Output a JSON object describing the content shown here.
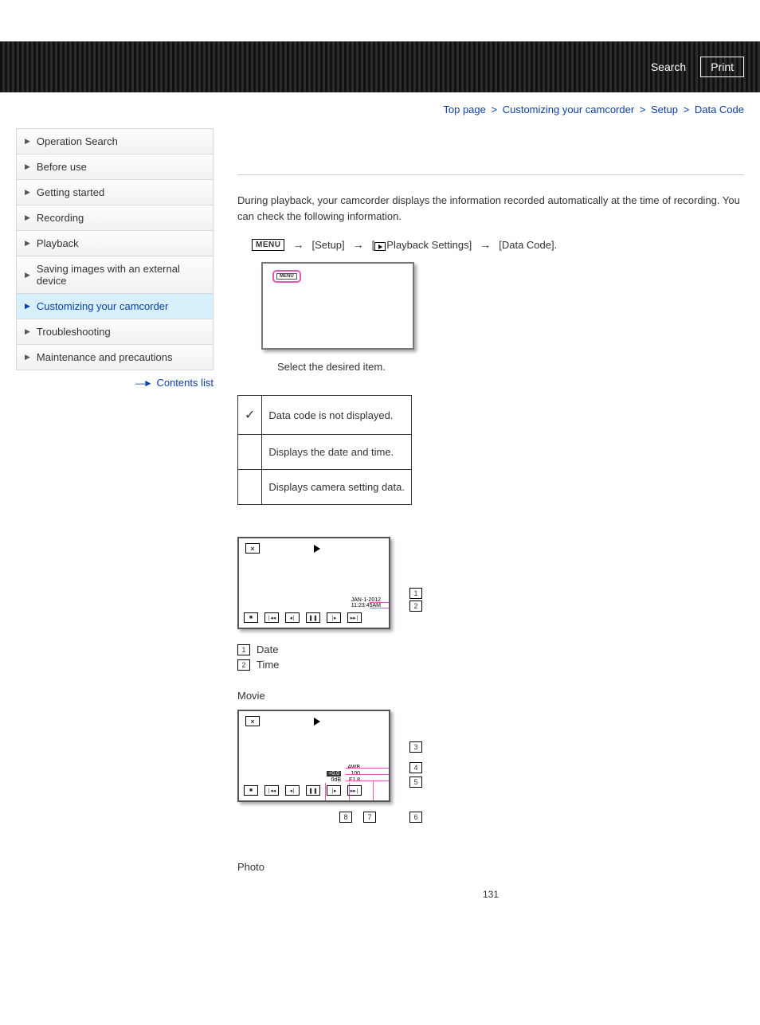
{
  "banner": {
    "search": "Search",
    "print": "Print"
  },
  "breadcrumbs": {
    "top": "Top page",
    "c1": "Customizing your camcorder",
    "c2": "Setup",
    "current": "Data Code"
  },
  "sidebar": {
    "items": [
      "Operation Search",
      "Before use",
      "Getting started",
      "Recording",
      "Playback",
      "Saving images with an external device",
      "Customizing your camcorder",
      "Troubleshooting",
      "Maintenance and precautions"
    ],
    "contents_link": "Contents list"
  },
  "main": {
    "intro": "During playback, your camcorder displays the information recorded automatically at the time of recording. You can check the following information.",
    "path": {
      "menu_label": "MENU",
      "setup": "[Setup]",
      "playback_settings": "Playback Settings]",
      "data_code": "[Data Code]."
    },
    "chip_label": "MENU",
    "caption": "Select the desired item.",
    "options": [
      "Data code is not displayed.",
      "Displays the date and time.",
      "Displays camera setting data."
    ],
    "lcd_date": {
      "line1": "JAN-1-2012",
      "line2": "11:23:45AM"
    },
    "legend": {
      "l1": "Date",
      "l2": "Time"
    },
    "movie_heading": "Movie",
    "lcd_movie": {
      "awb": "AWB",
      "iso": "100",
      "ev": "+0.0",
      "f": "F1.8",
      "db": "0dB"
    },
    "photo_heading": "Photo",
    "page_number": "131"
  }
}
